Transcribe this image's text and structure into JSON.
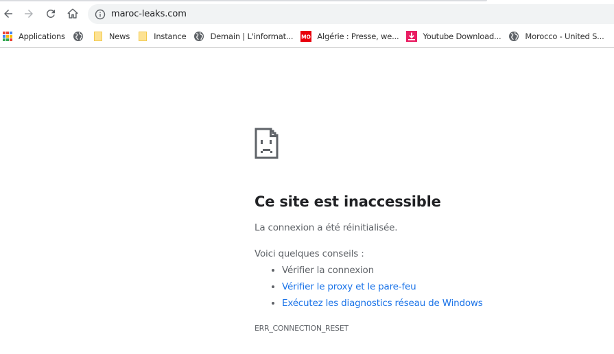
{
  "browser": {
    "nav": {
      "back_icon": "arrow-left-icon",
      "forward_icon": "arrow-right-icon",
      "reload_icon": "reload-icon",
      "home_icon": "home-icon"
    },
    "omnibox": {
      "security_icon": "info-circle-icon",
      "url": "maroc-leaks.com"
    },
    "bookmarks": [
      {
        "icon": "apps-grid-icon",
        "label": "Applications"
      },
      {
        "icon": "globe-icon",
        "label": ""
      },
      {
        "icon": "folder-icon",
        "label": "News"
      },
      {
        "icon": "folder-icon",
        "label": "Instance"
      },
      {
        "icon": "globe-icon",
        "label": "Demain | L'informat..."
      },
      {
        "icon": "mo-badge-icon",
        "label": "Algérie : Presse, we...",
        "badge_text": "MO"
      },
      {
        "icon": "download-icon",
        "label": "Youtube Download..."
      },
      {
        "icon": "globe-icon",
        "label": "Morocco - United S..."
      }
    ]
  },
  "error_page": {
    "icon": "sad-page-icon",
    "title": "Ce site est inaccessible",
    "description": "La connexion a été réinitialisée.",
    "tips_heading": "Voici quelques conseils :",
    "tips": [
      {
        "text": "Vérifier la connexion",
        "link": false
      },
      {
        "text": "Vérifier le proxy et le pare-feu",
        "link": true
      },
      {
        "text": "Exécutez les diagnostics réseau de Windows",
        "link": true
      }
    ],
    "error_code": "ERR_CONNECTION_RESET"
  },
  "colors": {
    "link": "#1a73e8",
    "omnibox_bg": "#f1f3f4",
    "text_secondary": "#5f6368",
    "title": "#202124",
    "mo_badge": "#e8000b",
    "download_badge": "#e91e63",
    "folder": "#fdd663"
  }
}
